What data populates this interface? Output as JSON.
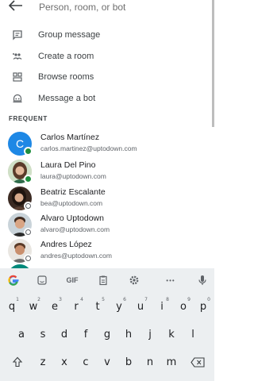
{
  "search": {
    "placeholder": "Person, room, or bot"
  },
  "actions": [
    {
      "label": "Group message",
      "icon": "chat-bubble-icon"
    },
    {
      "label": "Create a room",
      "icon": "group-add-icon"
    },
    {
      "label": "Browse rooms",
      "icon": "browse-rooms-icon"
    },
    {
      "label": "Message a bot",
      "icon": "bot-icon"
    }
  ],
  "frequent": {
    "label": "FREQUENT",
    "contacts": [
      {
        "name": "Carlos Martínez",
        "email": "carlos.martinez@uptodown.com",
        "presence": "available",
        "avatar": "C",
        "avatar_color": "#1e88e5"
      },
      {
        "name": "Laura Del Pino",
        "email": "laura@uptodown.com",
        "presence": "available",
        "avatar_color": "#b97a63"
      },
      {
        "name": "Beatriz Escalante",
        "email": "bea@uptodown.com",
        "presence": "offline",
        "avatar_color": "#6d4c41"
      },
      {
        "name": "Alvaro Uptodown",
        "email": "alvaro@uptodown.com",
        "presence": "offline",
        "avatar_color": "#8d6e63"
      },
      {
        "name": "Andres López",
        "email": "andres@uptodown.com",
        "presence": "offline",
        "avatar_color": "#a1887f"
      }
    ]
  },
  "keyboard": {
    "toolbar": [
      "google-g-icon",
      "sticker-icon",
      "GIF",
      "clipboard-icon",
      "settings-gear-icon",
      "more-icon",
      "mic-icon"
    ],
    "gif_label": "GIF",
    "more_label": "•••",
    "row1": [
      {
        "k": "q",
        "hint": "1"
      },
      {
        "k": "w",
        "hint": "2"
      },
      {
        "k": "e",
        "hint": "3"
      },
      {
        "k": "r",
        "hint": "4"
      },
      {
        "k": "t",
        "hint": "5"
      },
      {
        "k": "y",
        "hint": "6"
      },
      {
        "k": "u",
        "hint": "7"
      },
      {
        "k": "i",
        "hint": "8"
      },
      {
        "k": "o",
        "hint": "9"
      },
      {
        "k": "p",
        "hint": "0"
      }
    ],
    "row2": [
      "a",
      "s",
      "d",
      "f",
      "g",
      "h",
      "j",
      "k",
      "l"
    ],
    "row3": [
      "z",
      "x",
      "c",
      "v",
      "b",
      "n",
      "m"
    ]
  },
  "colors": {
    "accent": "#1a73e8",
    "available": "#1e8e3e",
    "keyboard_bg": "#eceff1"
  }
}
